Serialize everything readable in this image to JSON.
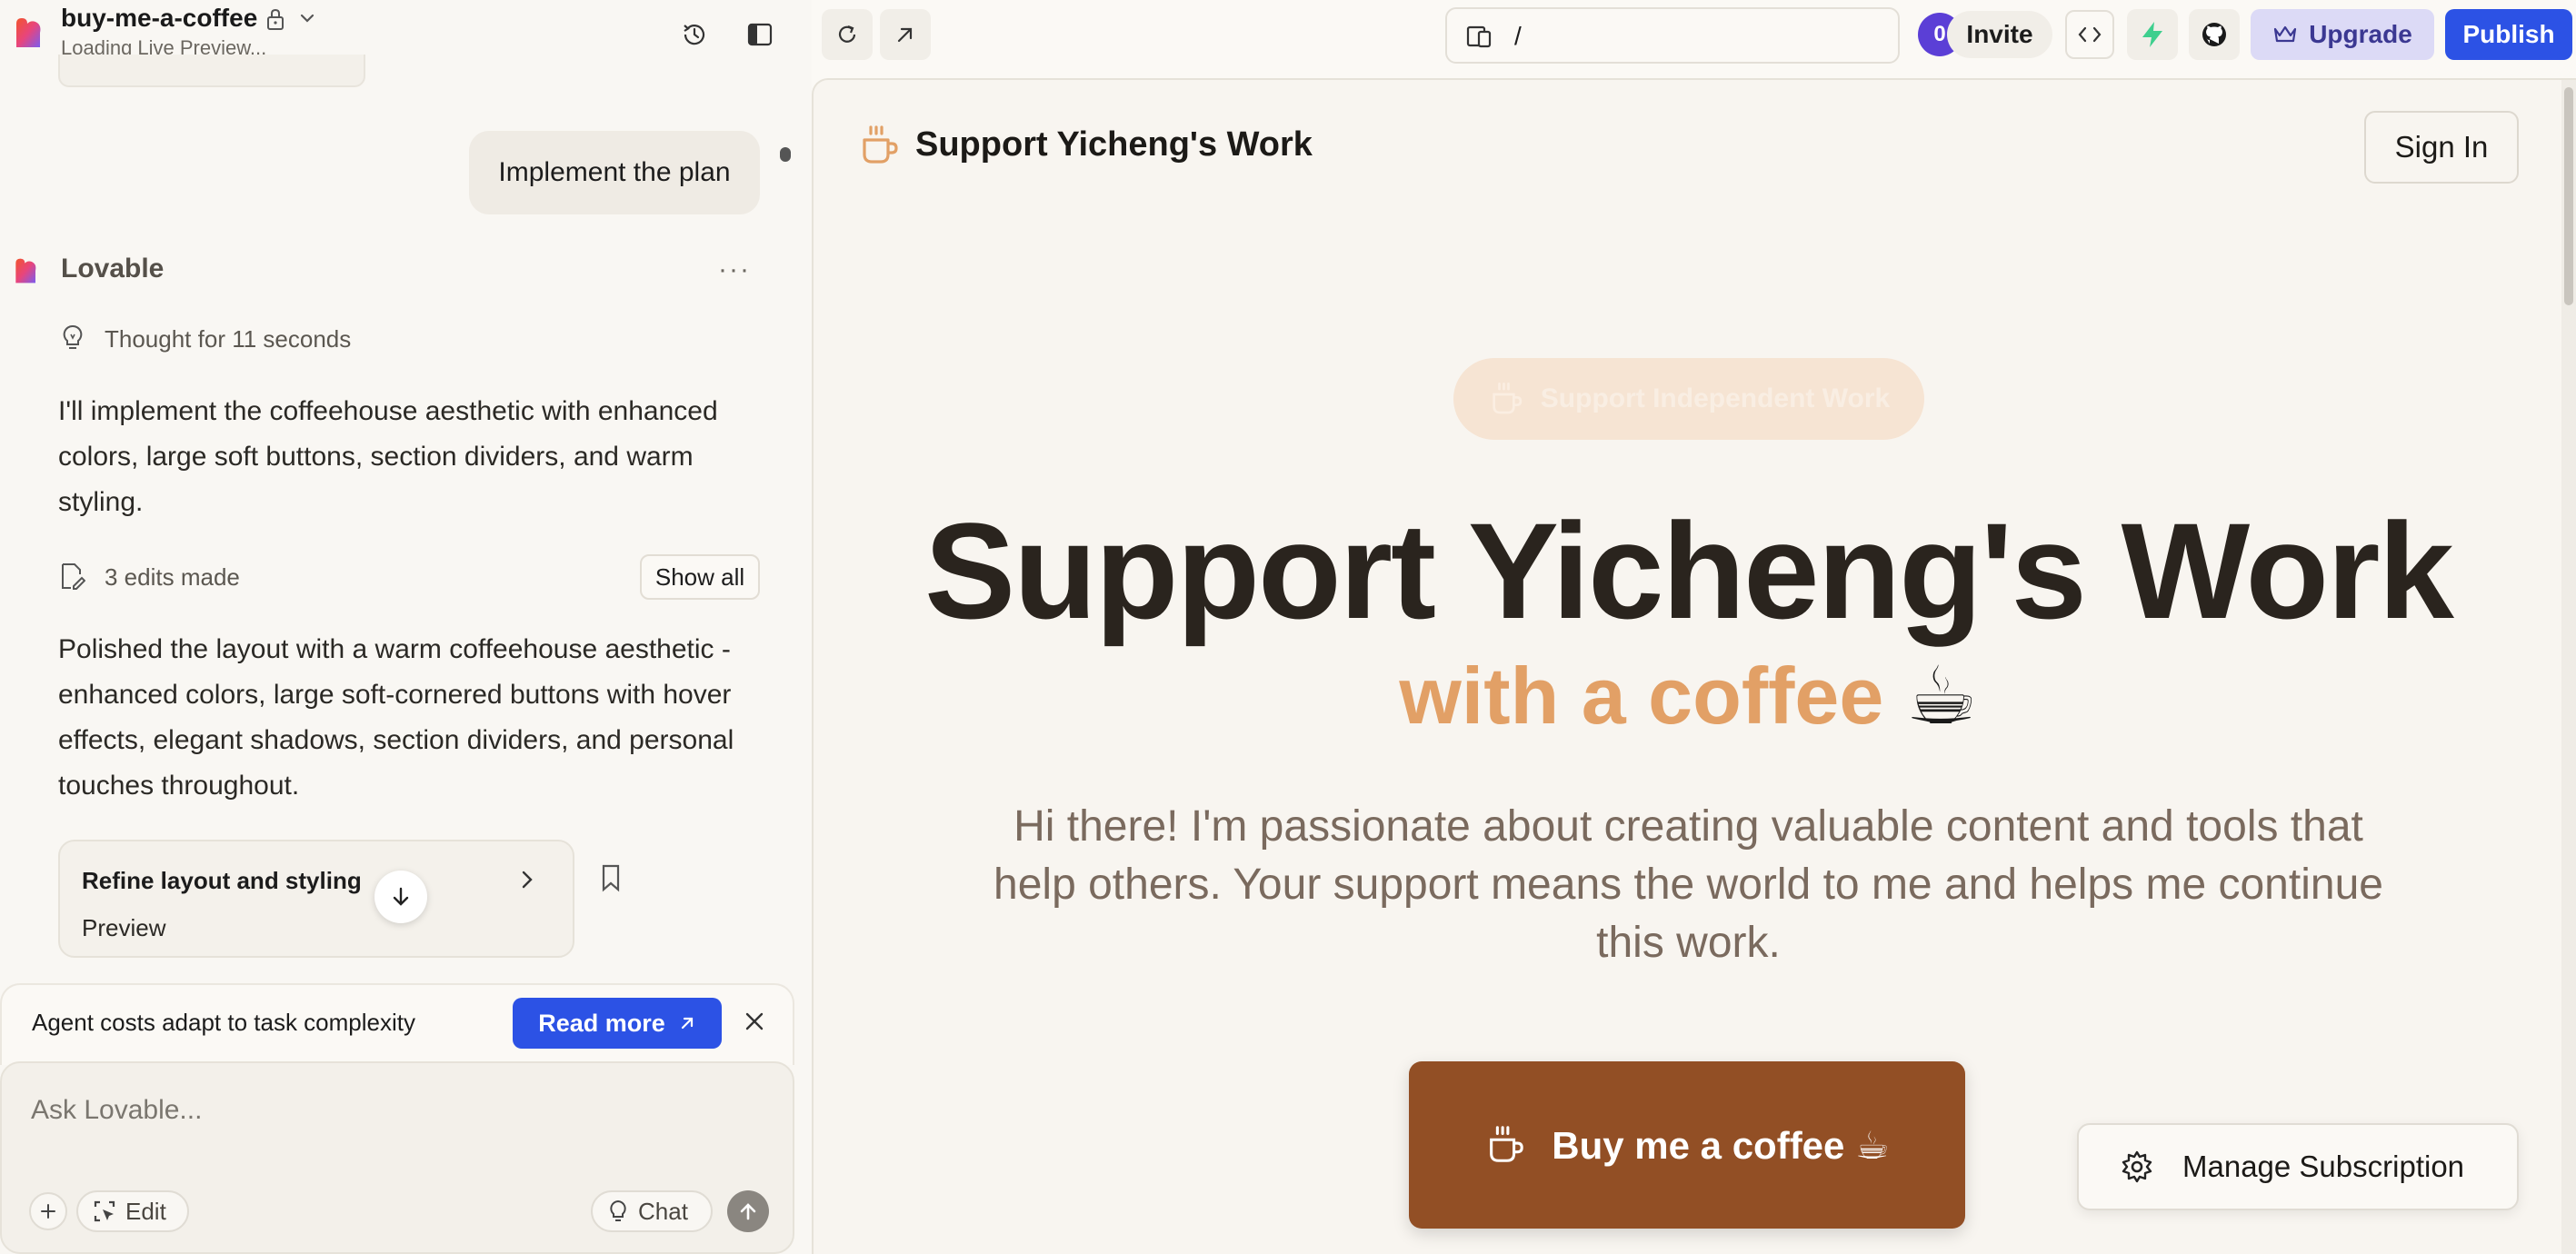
{
  "project": {
    "name": "buy-me-a-coffee",
    "status": "Loading Live Preview..."
  },
  "chat": {
    "user_message": "Implement the plan",
    "assistant_name": "Lovable",
    "thought": "Thought for 11 seconds",
    "paragraph1": "I'll implement the coffeehouse aesthetic with enhanced colors, large soft buttons, section dividers, and warm styling.",
    "edits_label": "3 edits made",
    "show_all_label": "Show all",
    "paragraph2": "Polished the layout with a warm coffeehouse aesthetic - enhanced colors, large soft-cornered buttons with hover effects, elegant shadows, section dividers, and personal touches throughout.",
    "version_card": {
      "title": "Refine layout and styling",
      "subtitle": "Preview"
    }
  },
  "notice": {
    "text": "Agent costs adapt to task complexity",
    "read_more_label": "Read more"
  },
  "composer": {
    "placeholder": "Ask Lovable...",
    "edit_label": "Edit",
    "chat_label": "Chat"
  },
  "toolbar": {
    "url_path": "/",
    "avatar_initial": "0",
    "invite_label": "Invite",
    "upgrade_label": "Upgrade",
    "publish_label": "Publish"
  },
  "preview": {
    "site_title": "Support Yicheng's Work",
    "sign_in_label": "Sign In",
    "badge_label": "Support Independent Work",
    "hero_title": "Support Yicheng's Work",
    "hero_subtitle": "with a coffee",
    "hero_subtitle_emoji": "☕",
    "hero_description": "Hi there! I'm passionate about creating valuable content and tools that help others. Your support means the world to me and helps me continue this work.",
    "buy_button_label": "Buy me a coffee ☕",
    "manage_subscription_label": "Manage Subscription"
  },
  "colors": {
    "accent_blue": "#2c52e5",
    "coffee_brown": "#924f25",
    "coffee_orange": "#e2a066",
    "upgrade_bg": "#dcdaf6"
  },
  "icons": {
    "logo": "lovable-heart-icon",
    "lock": "lock-icon",
    "history": "history-icon",
    "sidebar": "sidebar-toggle-icon",
    "refresh": "refresh-icon",
    "open_external": "external-link-icon",
    "code": "code-icon",
    "supabase": "bolt-icon",
    "github": "github-icon",
    "crown": "crown-icon",
    "coffee": "coffee-cup-icon",
    "gear": "gear-icon"
  }
}
